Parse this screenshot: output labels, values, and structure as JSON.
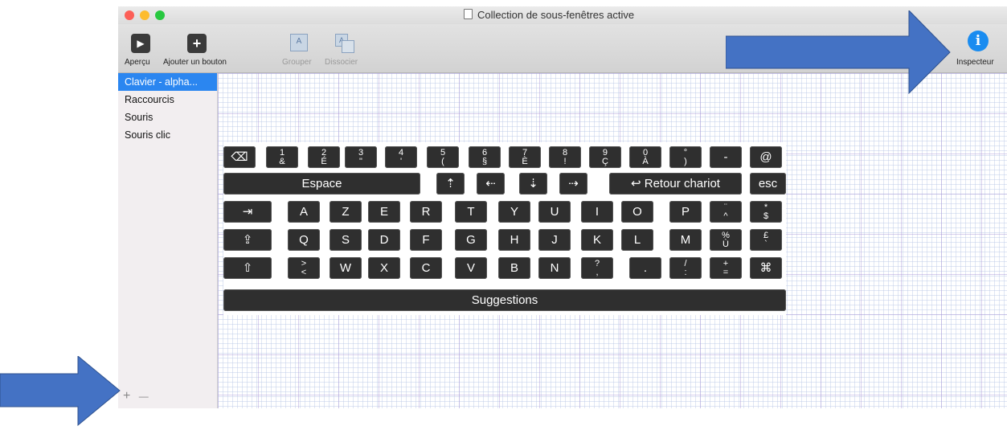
{
  "window": {
    "title": "Collection de sous-fenêtres active",
    "traffic_lights": [
      "#fc5f57",
      "#fdbc2e",
      "#28c840"
    ]
  },
  "toolbar": {
    "apercu_label": "Aperçu",
    "ajouter_label": "Ajouter un bouton",
    "grouper_label": "Grouper",
    "dissocier_label": "Dissocier",
    "inspecteur_label": "Inspecteur",
    "inspecteur_glyph": "i",
    "play_glyph": "▶",
    "plus_glyph": "+",
    "group_glyph": "A"
  },
  "sidebar": {
    "items": [
      {
        "label": "Clavier - alpha..."
      },
      {
        "label": "Raccourcis"
      },
      {
        "label": "Souris"
      },
      {
        "label": "Souris clic"
      }
    ],
    "add_glyph": "+",
    "remove_glyph": "—"
  },
  "keyboard": {
    "row1": [
      {
        "top": "",
        "bottom": "⌫"
      },
      {
        "top": "1",
        "bottom": "&"
      },
      {
        "top": "2",
        "bottom": "É"
      },
      {
        "top": "3",
        "bottom": "\""
      },
      {
        "top": "4",
        "bottom": "'"
      },
      {
        "top": "5",
        "bottom": "("
      },
      {
        "top": "6",
        "bottom": "§"
      },
      {
        "top": "7",
        "bottom": "È"
      },
      {
        "top": "8",
        "bottom": "!"
      },
      {
        "top": "9",
        "bottom": "Ç"
      },
      {
        "top": "0",
        "bottom": "À"
      },
      {
        "top": "°",
        "bottom": ")"
      },
      {
        "top": "",
        "bottom": "-"
      },
      {
        "top": "",
        "bottom": "@"
      }
    ],
    "row2": [
      "Espace",
      "⇡",
      "⇠",
      "⇣",
      "⇢",
      "↩ Retour chariot",
      "esc"
    ],
    "row3": [
      {
        "top": "",
        "bottom": "⇥"
      },
      {
        "top": "",
        "bottom": "A"
      },
      {
        "top": "",
        "bottom": "Z"
      },
      {
        "top": "",
        "bottom": "E"
      },
      {
        "top": "",
        "bottom": "R"
      },
      {
        "top": "",
        "bottom": "T"
      },
      {
        "top": "",
        "bottom": "Y"
      },
      {
        "top": "",
        "bottom": "U"
      },
      {
        "top": "",
        "bottom": "I"
      },
      {
        "top": "",
        "bottom": "O"
      },
      {
        "top": "",
        "bottom": "P"
      },
      {
        "top": "¨",
        "bottom": "^"
      },
      {
        "top": "*",
        "bottom": "$"
      }
    ],
    "row4": [
      {
        "top": "",
        "bottom": "⇪"
      },
      {
        "top": "",
        "bottom": "Q"
      },
      {
        "top": "",
        "bottom": "S"
      },
      {
        "top": "",
        "bottom": "D"
      },
      {
        "top": "",
        "bottom": "F"
      },
      {
        "top": "",
        "bottom": "G"
      },
      {
        "top": "",
        "bottom": "H"
      },
      {
        "top": "",
        "bottom": "J"
      },
      {
        "top": "",
        "bottom": "K"
      },
      {
        "top": "",
        "bottom": "L"
      },
      {
        "top": "",
        "bottom": "M"
      },
      {
        "top": "%",
        "bottom": "Ù"
      },
      {
        "top": "£",
        "bottom": "`"
      }
    ],
    "row5": [
      {
        "top": "",
        "bottom": "⇧"
      },
      {
        "top": ">",
        "bottom": "<"
      },
      {
        "top": "",
        "bottom": "W"
      },
      {
        "top": "",
        "bottom": "X"
      },
      {
        "top": "",
        "bottom": "C"
      },
      {
        "top": "",
        "bottom": "V"
      },
      {
        "top": "",
        "bottom": "B"
      },
      {
        "top": "",
        "bottom": "N"
      },
      {
        "top": "?",
        "bottom": ","
      },
      {
        "top": "",
        "bottom": "."
      },
      {
        "top": "/",
        "bottom": ":"
      },
      {
        "top": "+",
        "bottom": "="
      },
      {
        "top": "",
        "bottom": "⌘"
      }
    ],
    "row6": [
      "Suggestions"
    ]
  },
  "colors": {
    "selection": "#2b86f0",
    "key_bg": "#2f2f2f",
    "annotation_arrow": "#4472c4",
    "inspector_icon": "#1a8cf0"
  }
}
